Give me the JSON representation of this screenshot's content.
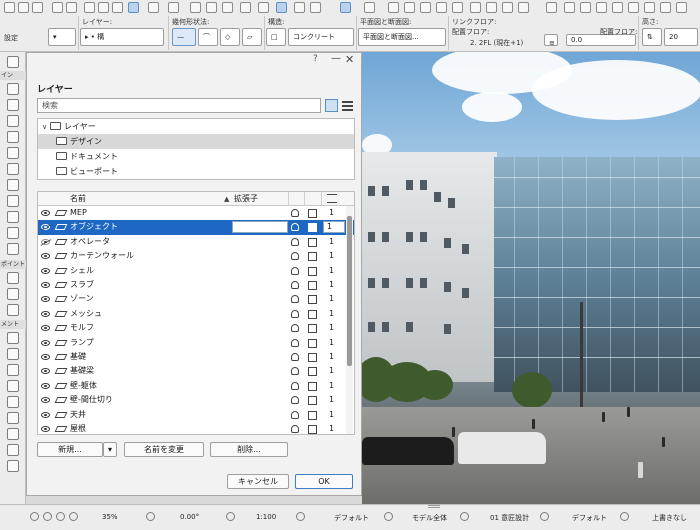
{
  "toolbar": {
    "labels": {
      "layer": "レイヤー:",
      "geometry": "幾何形状法:",
      "structure": "構造:",
      "floor_plan": "平面図と断面図:",
      "link_floor": "リンクフロア:",
      "height": "高さ:",
      "placement_floor": "配置フロア:",
      "set": "設定"
    },
    "layer_value": "▸  • 構",
    "structure_value": "コンクリート",
    "floor_plan_value": "平面図と断面図...",
    "link_floor_value": "2. 2FL (現在+1)",
    "placement_floor_label": "配置フロア:",
    "placement_value": "0.0",
    "height_value": "20"
  },
  "toolbox": {
    "section_in": "イン",
    "section_point": "ポイント",
    "section_ment": "メント"
  },
  "dialog": {
    "help": "?",
    "minimize": "—",
    "close": "✕",
    "title": "レイヤー",
    "search_placeholder": "検索",
    "tree": [
      {
        "label": "レイヤー",
        "caret": "∨",
        "level": 0
      },
      {
        "label": "デザイン",
        "level": 1,
        "selected": true
      },
      {
        "label": "ドキュメント",
        "level": 1
      },
      {
        "label": "ビューポート",
        "level": 1
      }
    ],
    "columns": {
      "name": "名前",
      "sort_arrow": "▲",
      "extension": "拡張子"
    },
    "layers": [
      {
        "name": "MEP",
        "num": "1",
        "visible": true
      },
      {
        "name": "オブジェクト",
        "num": "1",
        "visible": false,
        "selected": true
      },
      {
        "name": "オペレータ",
        "num": "1",
        "visible": false
      },
      {
        "name": "カーテンウォール",
        "num": "1",
        "visible": true
      },
      {
        "name": "シェル",
        "num": "1",
        "visible": true
      },
      {
        "name": "スラブ",
        "num": "1",
        "visible": true
      },
      {
        "name": "ゾーン",
        "num": "1",
        "visible": true
      },
      {
        "name": "メッシュ",
        "num": "1",
        "visible": true
      },
      {
        "name": "モルフ",
        "num": "1",
        "visible": true
      },
      {
        "name": "ランプ",
        "num": "1",
        "visible": true
      },
      {
        "name": "基礎",
        "num": "1",
        "visible": true
      },
      {
        "name": "基礎梁",
        "num": "1",
        "visible": true
      },
      {
        "name": "壁-躯体",
        "num": "1",
        "visible": true
      },
      {
        "name": "壁-間仕切り",
        "num": "1",
        "visible": true
      },
      {
        "name": "天井",
        "num": "1",
        "visible": true
      },
      {
        "name": "屋根",
        "num": "1",
        "visible": true
      }
    ],
    "buttons": {
      "new": "新規...",
      "dropdown": "▾",
      "rename": "名前を変更",
      "delete": "削除...",
      "cancel": "キャンセル",
      "ok": "OK"
    }
  },
  "statusbar": {
    "zoom": "35%",
    "angle": "0.00°",
    "scale": "1:100",
    "pen": "デフォルト",
    "model": "モデル全体",
    "design": "01 意匠設計",
    "default2": "デフォルト",
    "overwrite": "上書きなし"
  },
  "colors": {
    "selection": "#1e68c4",
    "accent_button": "#3d7cc7"
  }
}
